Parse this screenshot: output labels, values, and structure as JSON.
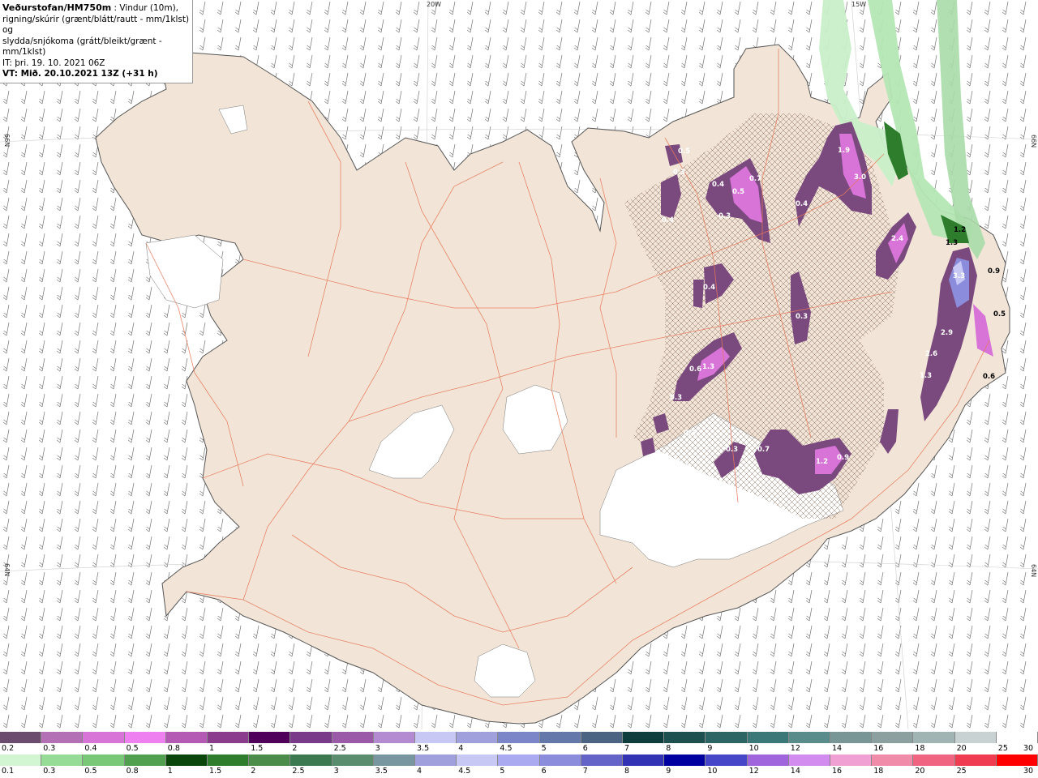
{
  "header": {
    "title": "Veðurstofan/HM750m",
    "desc_1": " : Vindur (10m),",
    "desc_2": "rigning/skúrir (grænt/blátt/rautt - mm/1klst) og",
    "desc_3": "slydda/snjókoma (grátt/bleikt/grænt - mm/1klst)",
    "issue_time": "IT: þri. 19. 10. 2021 06Z",
    "valid_time": "VT: Mið. 20.10.2021 13Z (+31 h)"
  },
  "map_labels": {
    "lon_20w": "20W",
    "lon_15w": "15W",
    "lat_66n_left": "66N",
    "lat_66n_right": "66N",
    "lat_64n_left": "64N",
    "lat_64n_right": "64N"
  },
  "precip_labels": [
    {
      "text": "0.5"
    },
    {
      "text": "0.3"
    },
    {
      "text": "0.4"
    },
    {
      "text": "0.5"
    },
    {
      "text": "0.7"
    },
    {
      "text": "0.3"
    },
    {
      "text": "0.4"
    },
    {
      "text": "1.9"
    },
    {
      "text": "3.0"
    },
    {
      "text": "0.4"
    },
    {
      "text": "2.4"
    },
    {
      "text": "0.4"
    },
    {
      "text": "3.3"
    },
    {
      "text": "2.9"
    },
    {
      "text": "2.6"
    },
    {
      "text": "1.3"
    },
    {
      "text": "0.3"
    },
    {
      "text": "0.6"
    },
    {
      "text": "1.3"
    },
    {
      "text": "0.3"
    },
    {
      "text": "0.3"
    },
    {
      "text": "0.7"
    },
    {
      "text": "1.2"
    },
    {
      "text": "0.9"
    },
    {
      "text": "0.3"
    },
    {
      "text": "1.2"
    },
    {
      "text": "1.3"
    },
    {
      "text": "0.5"
    },
    {
      "text": "0.9"
    },
    {
      "text": "0.6"
    }
  ],
  "legend_snow": {
    "colors": [
      "#6b4b6e",
      "#b470b4",
      "#d873d8",
      "#ef80ef",
      "#b45ab4",
      "#8c3c8c",
      "#50005a",
      "#7a3a8a",
      "#9b5aa8",
      "#b48ad0",
      "#c8c8f5",
      "#a0a0dc",
      "#7a86c8",
      "#6478aa",
      "#4b6482",
      "#0f3c3c",
      "#1e5050",
      "#2d6464",
      "#3c7878",
      "#5a8c8c",
      "#789696",
      "#8ca0a0",
      "#a0b4b4",
      "#c8d2d2",
      "#ffffff"
    ],
    "labels": [
      "0.2",
      "0.3",
      "0.4",
      "0.5",
      "0.8",
      "1",
      "1.5",
      "2",
      "2.5",
      "3",
      "3.5",
      "4",
      "4.5",
      "5",
      "6",
      "7",
      "8",
      "9",
      "10",
      "12",
      "14",
      "16",
      "18",
      "20",
      "25",
      "30"
    ]
  },
  "legend_rain": {
    "colors": [
      "#d2f5d2",
      "#96dc96",
      "#78c878",
      "#50a050",
      "#0a460a",
      "#2d7d2d",
      "#4b8c4b",
      "#3c7850",
      "#5a8c6e",
      "#7896a0",
      "#a0a0dc",
      "#c8c8f5",
      "#aaaaf0",
      "#8c8cdc",
      "#6464c8",
      "#3232b4",
      "#0000a0",
      "#4646c8",
      "#a064dc",
      "#d28cf0",
      "#f0a0d2",
      "#f08caa",
      "#f06482",
      "#f03c50",
      "#ff0000"
    ],
    "labels": [
      "0.1",
      "0.3",
      "0.5",
      "0.8",
      "1",
      "1.5",
      "2",
      "2.5",
      "3",
      "3.5",
      "4",
      "4.5",
      "5",
      "6",
      "7",
      "8",
      "9",
      "10",
      "12",
      "14",
      "16",
      "18",
      "20",
      "25",
      "30"
    ]
  }
}
